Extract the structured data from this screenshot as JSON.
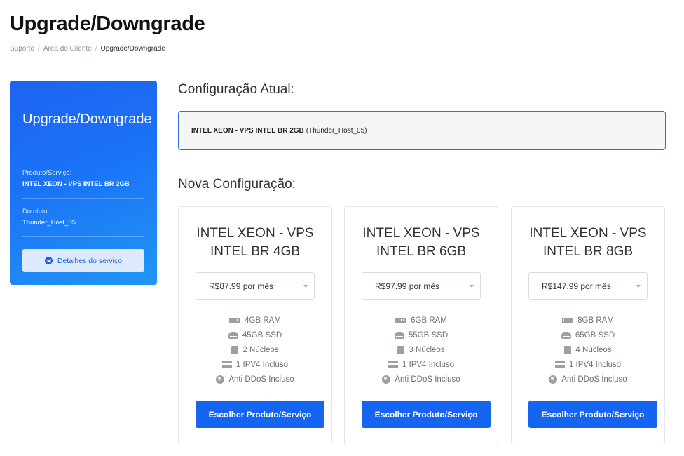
{
  "page": {
    "title": "Upgrade/Downgrade",
    "breadcrumb": [
      "Suporte",
      "Área do Cliente",
      "Upgrade/Downgrade"
    ]
  },
  "sidebar": {
    "title": "Upgrade/Downgrade",
    "product_label": "Produto/Serviço:",
    "product_value": "INTEL XEON - VPS INTEL BR 2GB",
    "domain_label": "Domínio:",
    "domain_value": "Thunder_Host_05",
    "details_button": "Detalhes do serviço"
  },
  "current": {
    "heading": "Configuração Atual:",
    "product_name": "INTEL XEON - VPS INTEL BR 2GB",
    "domain": "(Thunder_Host_05)"
  },
  "new_config": {
    "heading": "Nova Configuração:",
    "plans": [
      {
        "title_line1": "INTEL XEON - VPS",
        "title_line2": "INTEL BR 4GB",
        "price": "R$87.99 por mês",
        "features": [
          "4GB RAM",
          "45GB SSD",
          "2 Núcleos",
          "1 IPV4 Incluso",
          "Anti DDoS Incluso"
        ],
        "button": "Escolher Produto/Serviço"
      },
      {
        "title_line1": "INTEL XEON - VPS",
        "title_line2": "INTEL BR 6GB",
        "price": "R$97.99 por mês",
        "features": [
          "6GB RAM",
          "55GB SSD",
          "3 Núcleos",
          "1 IPV4 Incluso",
          "Anti DDoS Incluso"
        ],
        "button": "Escolher Produto/Serviço"
      },
      {
        "title_line1": "INTEL XEON - VPS",
        "title_line2": "INTEL BR 8GB",
        "price": "R$147.99 por mês",
        "features": [
          "8GB RAM",
          "65GB SSD",
          "4 Núcleos",
          "1 IPV4 Incluso",
          "Anti DDoS Incluso"
        ],
        "button": "Escolher Produto/Serviço"
      }
    ]
  },
  "icons": {
    "feature_icons": [
      "memory-icon",
      "hdd-icon",
      "cpu-icon",
      "server-icon",
      "globe-icon"
    ],
    "details_icon": "arrow-circle-left-icon"
  },
  "colors": {
    "accent": "#1565f2",
    "sidebar_gradient_start": "#1e63f0",
    "sidebar_gradient_end": "#2196f3",
    "current_border": "#2f6fe8"
  }
}
